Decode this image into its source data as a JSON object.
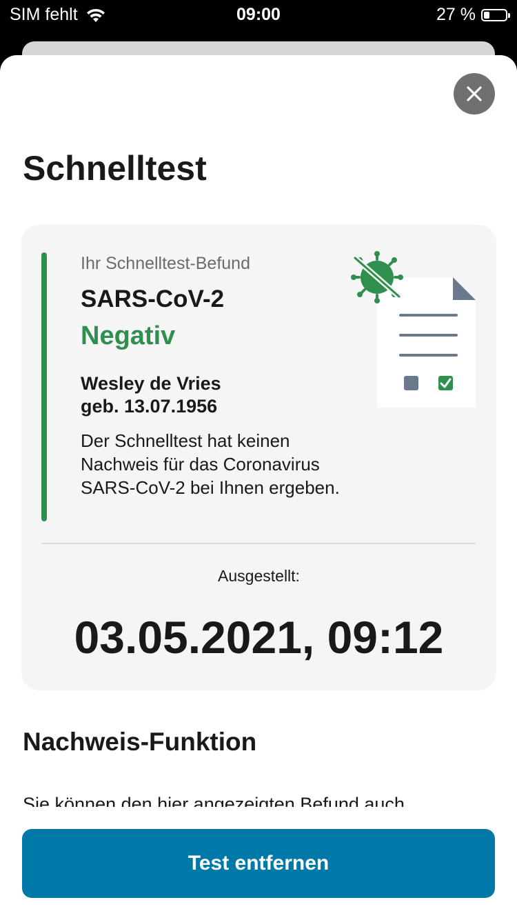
{
  "status_bar": {
    "carrier": "SIM fehlt",
    "time": "09:00",
    "battery_percent": "27 %",
    "battery_level": 0.27
  },
  "sheet": {
    "title": "Schnelltest",
    "close_icon": "close-icon"
  },
  "result_card": {
    "label": "Ihr Schnelltest-Befund",
    "virus": "SARS-CoV-2",
    "result": "Negativ",
    "name": "Wesley de Vries",
    "birth": "geb. 13.07.1956",
    "description": "Der Schnelltest hat keinen Nachweis für das Coronavirus SARS-CoV-2 bei Ihnen ergeben.",
    "issued_label": "Ausgestellt:",
    "issued_date": "03.05.2021, 09:12",
    "illustration_icon": "test-document-virus-icon"
  },
  "section": {
    "heading": "Nachweis-Funktion",
    "text": "Sie können den hier angezeigten Befund auch"
  },
  "actions": {
    "remove_label": "Test entfernen"
  },
  "colors": {
    "accent": "#0079a8",
    "negative_green": "#2f8f4e",
    "card_bg": "#f5f5f5"
  }
}
